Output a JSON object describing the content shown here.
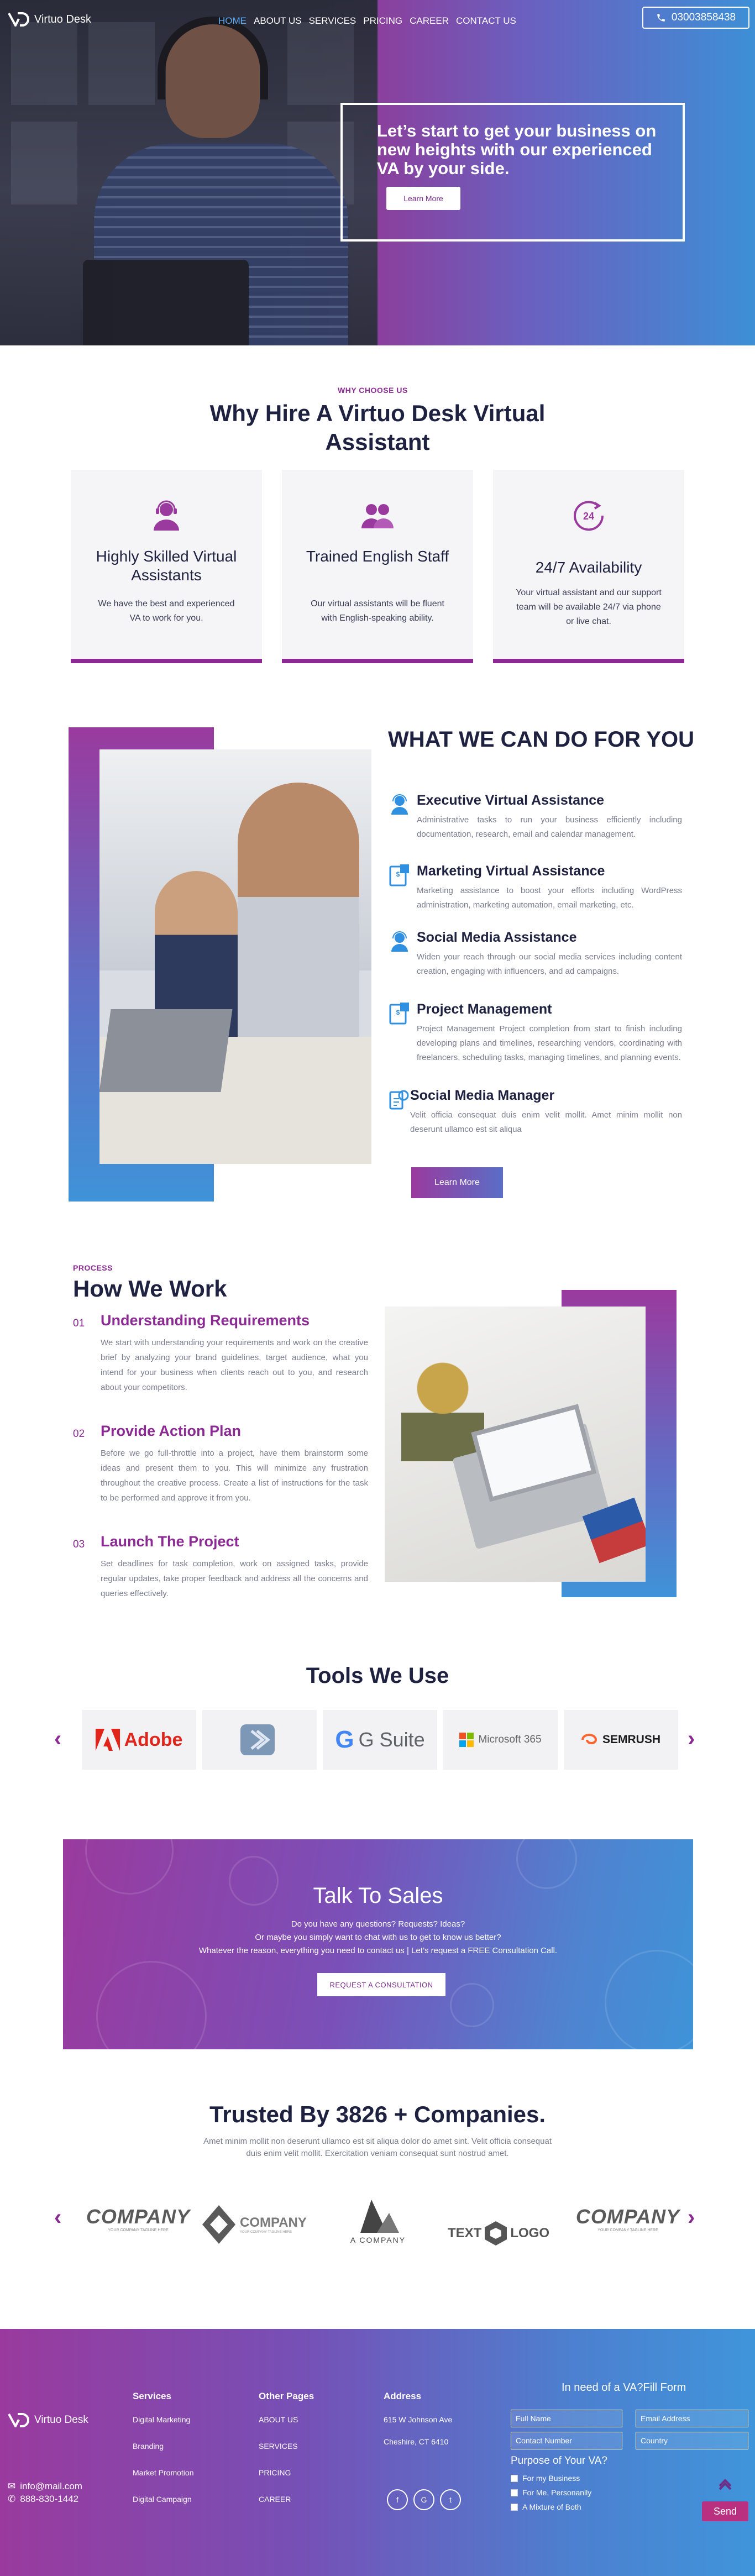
{
  "header": {
    "brand": "Virtuo Desk",
    "nav": [
      "HOME",
      "ABOUT US",
      "SERVICES",
      "PRICING",
      "CAREER",
      "CONTACT US"
    ],
    "phone": "03003858438"
  },
  "hero": {
    "headline": "Let’s start to get your business on new heights with our experienced VA by your side.",
    "cta": "Learn More"
  },
  "why": {
    "eyebrow": "WHY CHOOSE US",
    "title": "Why Hire A Virtuo Desk Virtual Assistant",
    "cards": [
      {
        "icon": "support-agent-icon",
        "title": "Highly Skilled Virtual Assistants",
        "text": "We have the best and experienced VA to work for you."
      },
      {
        "icon": "people-icon",
        "title": "Trained English Staff",
        "text": "Our virtual assistants will be fluent with English-speaking ability."
      },
      {
        "icon": "24-hours-icon",
        "title": "24/7 Availability",
        "text": "Your virtual assistant and our support team will be available 24/7 via phone or live chat."
      }
    ]
  },
  "services": {
    "title": "WHAT WE CAN DO FOR YOU",
    "items": [
      {
        "icon": "executive-icon",
        "title": "Executive Virtual Assistance",
        "text": "Administrative tasks to run your business efficiently including documentation, research, email and calendar management."
      },
      {
        "icon": "marketing-icon",
        "title": "Marketing Virtual Assistance",
        "text": "Marketing assistance to boost your efforts including WordPress administration, marketing automation, email marketing, etc."
      },
      {
        "icon": "social-icon",
        "title": "Social Media Assistance",
        "text": "Widen your reach through our social media services including content creation, engaging with influencers, and ad campaigns."
      },
      {
        "icon": "project-icon",
        "title": "Project Management",
        "text": "Project Management Project completion from start to finish including developing plans and timelines, researching vendors, coordinating with freelancers, scheduling tasks, managing timelines, and planning events."
      },
      {
        "icon": "manager-icon",
        "title": "Social Media Manager",
        "text": "Velit officia consequat duis enim velit mollit. Amet minim mollit non deserunt ullamco est sit aliqua"
      }
    ],
    "cta": "Learn More"
  },
  "process": {
    "eyebrow": "PROCESS",
    "title": "How We Work",
    "steps": [
      {
        "num": "01",
        "title": "Understanding Requirements",
        "text": "We start with understanding your requirements and work on the creative brief by analyzing your brand guidelines, target audience, what you intend for your business when clients reach out to you, and research about your competitors."
      },
      {
        "num": "02",
        "title": "Provide Action Plan",
        "text": "Before we go full-throttle into a project, have them brainstorm some ideas and present them to you. This will minimize any frustration throughout the creative process. Create a list of instructions for the task to be performed and approve it from you."
      },
      {
        "num": "03",
        "title": "Launch The Project",
        "text": "Set deadlines for task completion, work on assigned tasks, provide regular updates, take proper feedback and address all the concerns and queries effectively."
      }
    ]
  },
  "tools": {
    "title": "Tools We Use",
    "items": [
      "Adobe",
      "",
      "G Suite",
      "Microsoft 365",
      "SEMRUSH"
    ],
    "prev": "‹",
    "next": "›"
  },
  "sales": {
    "title": "Talk To Sales",
    "lines": [
      "Do you have any questions? Requests? Ideas?",
      "Or maybe you simply want to chat with us to get to know us better?",
      "Whatever the reason, everything you need to contact us | Let’s request a FREE Consultation Call."
    ],
    "cta": "REQUEST A CONSULTATION"
  },
  "trusted": {
    "title": "Trusted By 3826 + Companies.",
    "subtitle": "Amet minim mollit non deserunt ullamco est sit aliqua dolor do amet sint. Velit officia consequat duis enim velit mollit. Exercitation veniam consequat sunt nostrud amet.",
    "logos": [
      {
        "name": "COMPANY",
        "tag": "YOUR COMPANY TAGLINE HERE"
      },
      {
        "name": "COMPANY",
        "tag": "YOUR COMPANY TAGLINE HERE"
      },
      {
        "name": "A COMPANY",
        "tag": ""
      },
      {
        "name": "TEXT",
        "name2": "LOGO"
      },
      {
        "name": "COMPANY",
        "tag": "YOUR COMPANY TAGLINE HERE"
      }
    ],
    "prev": "‹",
    "next": "›"
  },
  "footer": {
    "brand": "Virtuo Desk",
    "email": "info@mail.com",
    "phone": "888-830-1442",
    "services_title": "Services",
    "services": [
      "Digital Marketing",
      "Branding",
      "Market Promotion",
      "Digital Campaign"
    ],
    "other_title": "Other Pages",
    "other": [
      "ABOUT US",
      "SERVICES",
      "PRICING",
      "CAREER"
    ],
    "address_title": "Address",
    "address_line1": "615 W Johnson Ave",
    "address_line2": "Cheshire, CT 6410",
    "form_title": "In need of a VA?Fill Form",
    "fields": [
      "Full Name",
      "Email Address",
      "Contact Number",
      "Country"
    ],
    "purpose_title": "Purpose of Your VA?",
    "options": [
      "For my Business",
      "For Me, Personanlly",
      "A Mixture of Both"
    ],
    "send": "Send"
  },
  "colors": {
    "primary": "#8a2a92",
    "accent": "#3f93d8",
    "heading": "#1e2140"
  }
}
